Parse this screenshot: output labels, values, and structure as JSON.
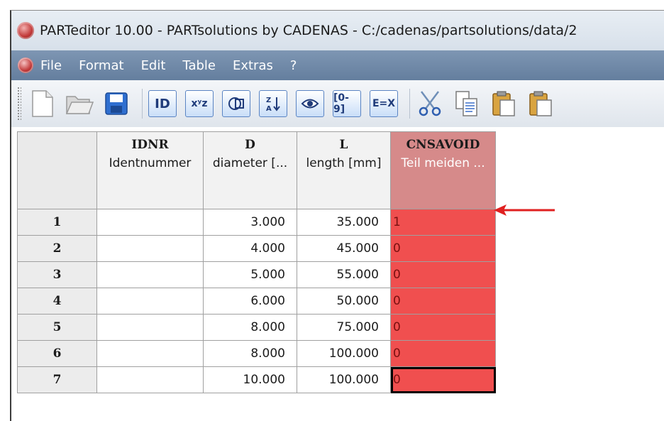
{
  "window": {
    "title": "PARTeditor 10.00 - PARTsolutions by CADENAS - C:/cadenas/partsolutions/data/2"
  },
  "menu": {
    "items": [
      "File",
      "Format",
      "Edit",
      "Table",
      "Extras",
      "?"
    ]
  },
  "toolbar": {
    "buttons": [
      {
        "icon": "new-document-icon"
      },
      {
        "icon": "open-folder-icon"
      },
      {
        "icon": "save-disk-icon"
      },
      {
        "icon": "id-icon",
        "label": "ID"
      },
      {
        "icon": "xyz-icon",
        "label": "xʸz"
      },
      {
        "icon": "geometry-icon"
      },
      {
        "icon": "sort-icon"
      },
      {
        "icon": "eye-icon"
      },
      {
        "icon": "range-icon",
        "label": "[0-9]"
      },
      {
        "icon": "formula-icon",
        "label": "E=X"
      },
      {
        "icon": "cut-icon"
      },
      {
        "icon": "copy-icon"
      },
      {
        "icon": "paste-icon"
      },
      {
        "icon": "paste-special-icon"
      }
    ]
  },
  "table": {
    "columns": [
      {
        "code": "IDNR",
        "desc": "Identnummer"
      },
      {
        "code": "D",
        "desc": "diameter [..."
      },
      {
        "code": "L",
        "desc": "length [mm]"
      },
      {
        "code": "CNSAVOID",
        "desc": "Teil meiden ..."
      }
    ],
    "rows": [
      {
        "index": "1",
        "idnr": "",
        "d": "3.000",
        "l": "35.000",
        "cnsavoid": "1"
      },
      {
        "index": "2",
        "idnr": "",
        "d": "4.000",
        "l": "45.000",
        "cnsavoid": "0"
      },
      {
        "index": "3",
        "idnr": "",
        "d": "5.000",
        "l": "55.000",
        "cnsavoid": "0"
      },
      {
        "index": "4",
        "idnr": "",
        "d": "6.000",
        "l": "50.000",
        "cnsavoid": "0"
      },
      {
        "index": "5",
        "idnr": "",
        "d": "8.000",
        "l": "75.000",
        "cnsavoid": "0"
      },
      {
        "index": "6",
        "idnr": "",
        "d": "8.000",
        "l": "100.000",
        "cnsavoid": "0"
      },
      {
        "index": "7",
        "idnr": "",
        "d": "10.000",
        "l": "100.000",
        "cnsavoid": "0"
      }
    ]
  },
  "colors": {
    "highlight_column": "#f04f4f",
    "highlight_header": "#d68a8a",
    "annotation_arrow": "#e02020",
    "menubar": "#6f88a8"
  }
}
